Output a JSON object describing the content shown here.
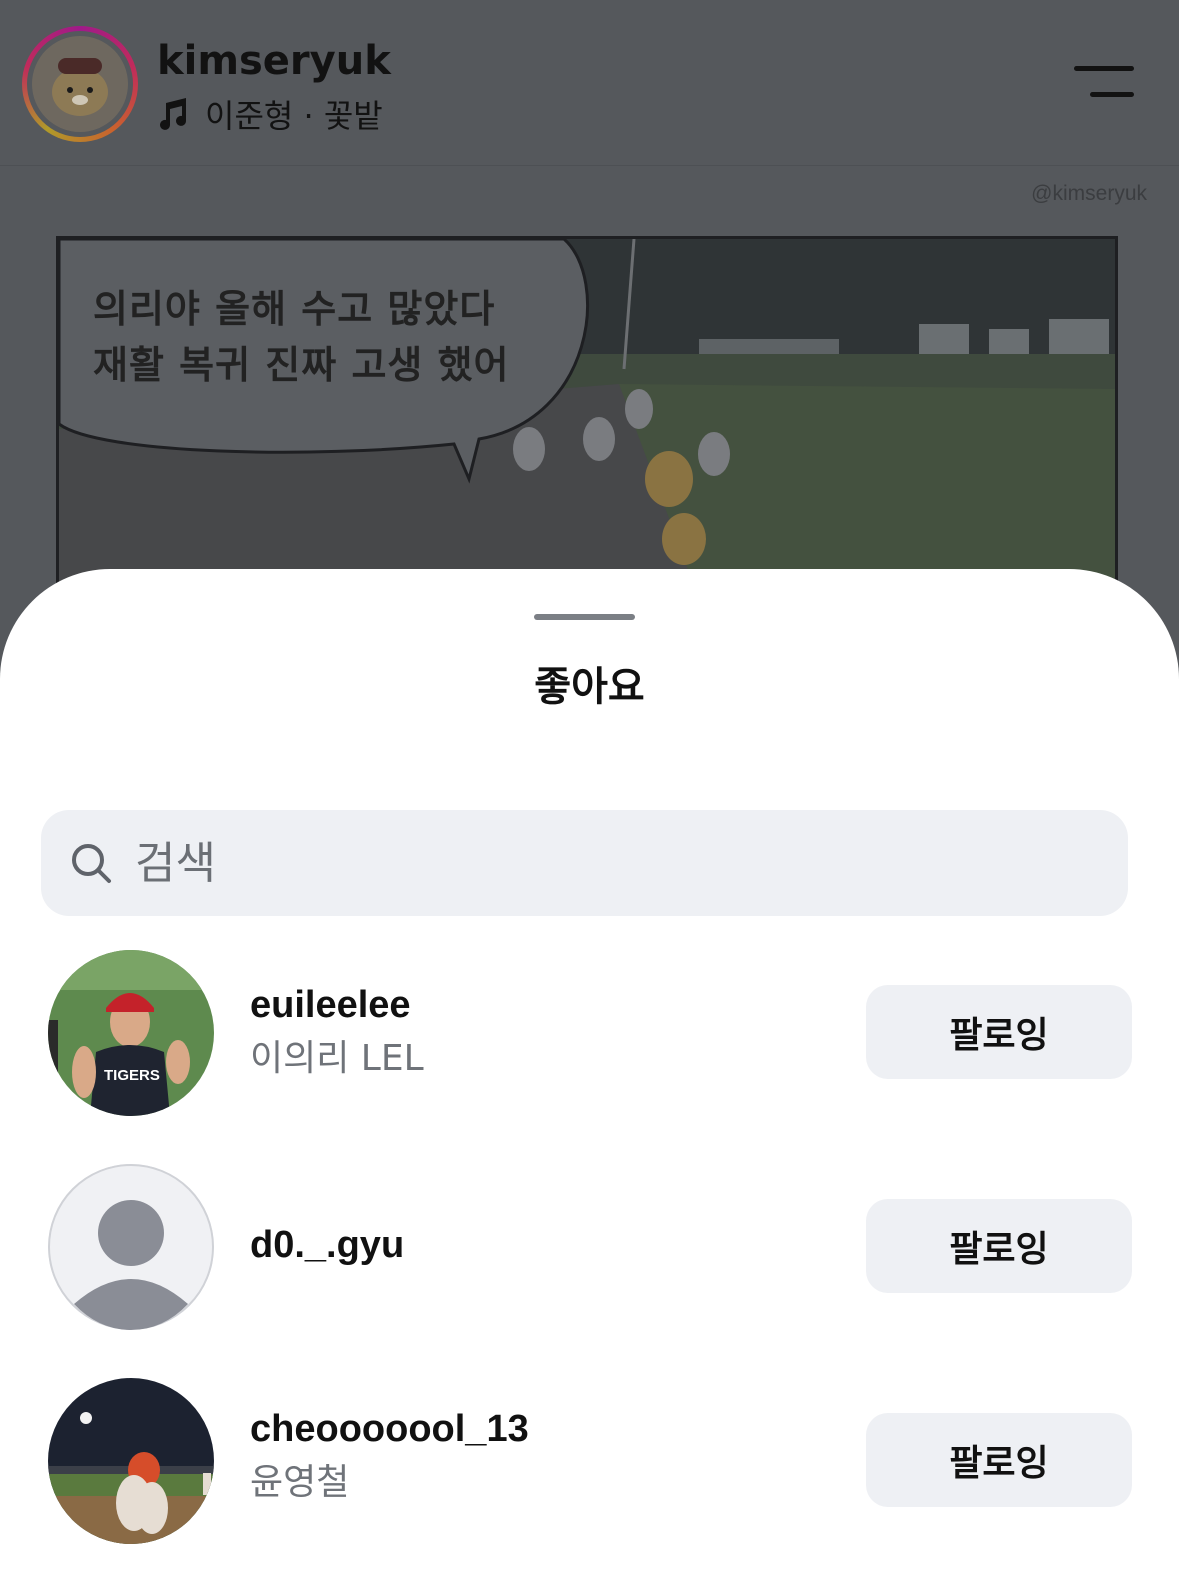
{
  "post": {
    "username": "kimseryuk",
    "music_info": "이준형 · 꽃밭",
    "watermark": "@kimseryuk",
    "comic_text_line1": "의리야 올해 수고 많았다",
    "comic_text_line2": "재활 복귀 진짜 고생 했어"
  },
  "sheet": {
    "title": "좋아요",
    "search_placeholder": "검색"
  },
  "users": [
    {
      "handle": "euileelee",
      "name": "이의리 LEL",
      "button": "팔로잉",
      "jersey_text": "TIGERS"
    },
    {
      "handle": "d0._.gyu",
      "name": "",
      "button": "팔로잉"
    },
    {
      "handle": "cheooooool_13",
      "name": "윤영철",
      "button": "팔로잉"
    }
  ]
}
